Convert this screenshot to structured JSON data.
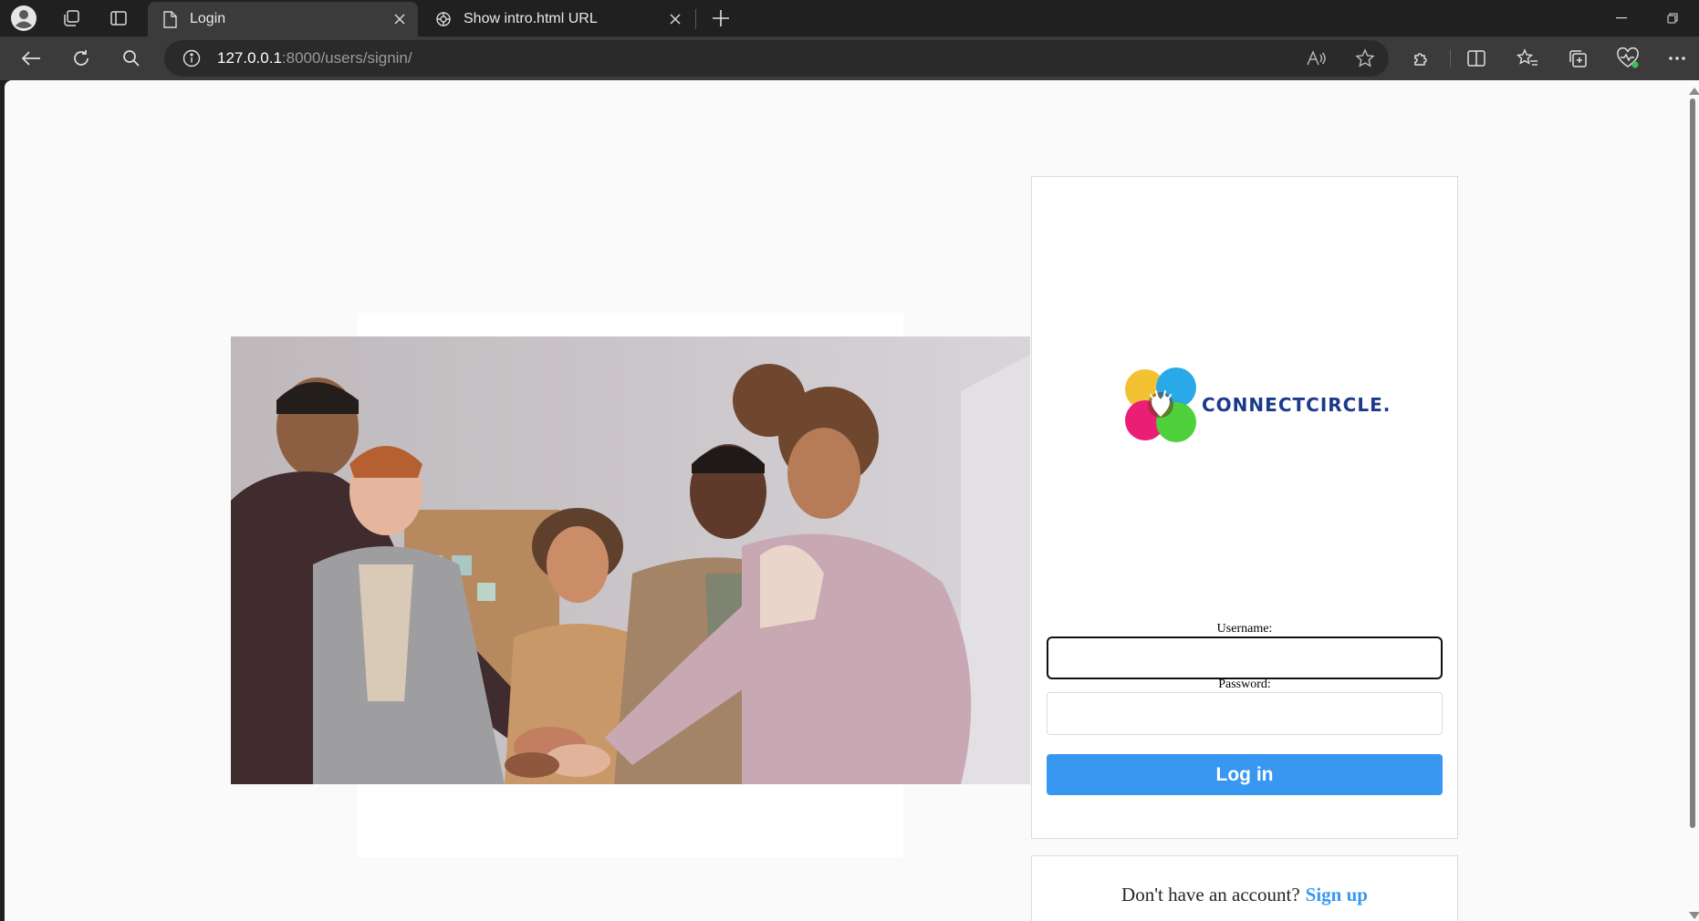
{
  "browser": {
    "tabs": [
      {
        "title": "Login",
        "active": true
      },
      {
        "title": "Show intro.html URL",
        "active": false
      }
    ],
    "address": {
      "host": "127.0.0.1",
      "rest": ":8000/users/signin/"
    }
  },
  "page": {
    "logo_text": "CONNECTCIRCLE.",
    "username_label": "Username:",
    "password_label": "Password:",
    "username_value": "",
    "password_value": "",
    "login_button": "Log in",
    "signup_prompt": "Don't have an account?",
    "signup_link": "Sign up"
  },
  "colors": {
    "accent": "#3897f0",
    "brand_text": "#1a3a8a",
    "logo_circles": [
      "#f2c233",
      "#29a9e8",
      "#ea1e75",
      "#4ed13b"
    ]
  },
  "icons": [
    "profile-icon",
    "workspaces-icon",
    "tab-actions-icon",
    "page-icon",
    "chatgpt-icon",
    "close-icon",
    "new-tab-icon",
    "minimize-icon",
    "restore-icon",
    "back-icon",
    "refresh-icon",
    "search-icon",
    "info-icon",
    "read-aloud-icon",
    "favorite-star-icon",
    "extensions-icon",
    "split-screen-icon",
    "favorites-icon",
    "collections-icon",
    "browser-essentials-icon",
    "more-icon"
  ]
}
